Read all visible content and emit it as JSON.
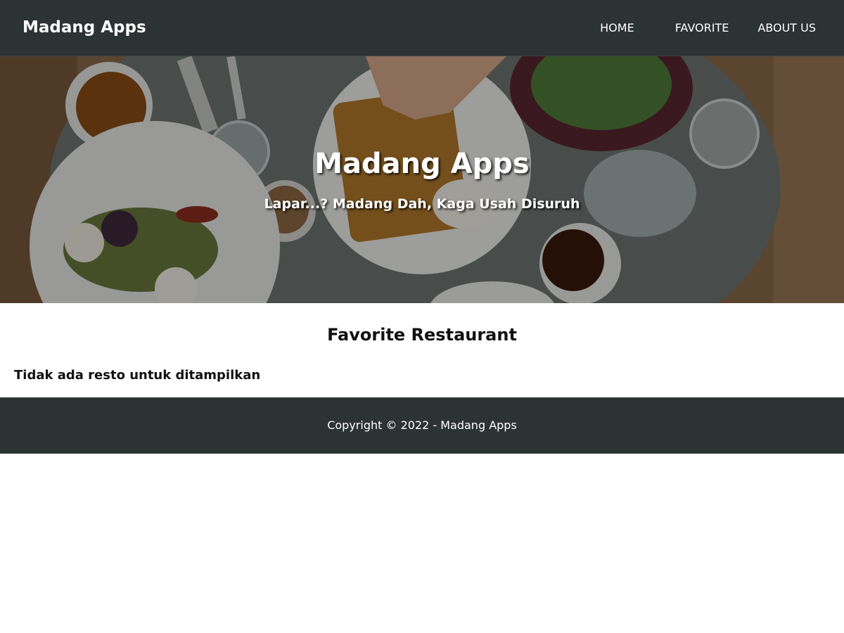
{
  "header": {
    "brand": "Madang Apps",
    "nav": [
      {
        "label": "HOME"
      },
      {
        "label": "FAVORITE"
      },
      {
        "label": "ABOUT US"
      }
    ]
  },
  "hero": {
    "title": "Madang Apps",
    "subtitle": "Lapar...? Madang Dah, Kaga Usah Disuruh"
  },
  "main": {
    "title": "Favorite Restaurant",
    "empty_message": "Tidak ada resto untuk ditampilkan"
  },
  "footer": {
    "copyright": "Copyright © 2022 - Madang Apps"
  },
  "colors": {
    "bar": "#2c3333",
    "text_light": "#ffffff",
    "text_dark": "#111111"
  }
}
